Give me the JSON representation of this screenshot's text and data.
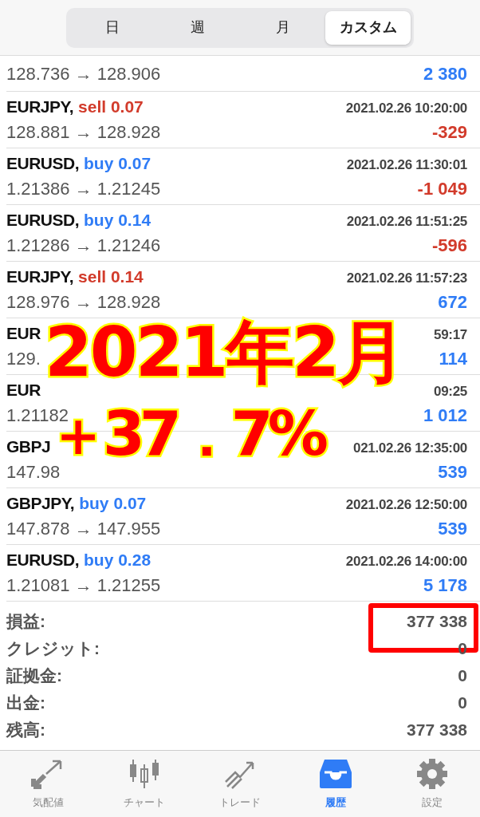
{
  "periods": [
    {
      "label": "日",
      "selected": false
    },
    {
      "label": "週",
      "selected": false
    },
    {
      "label": "月",
      "selected": false
    },
    {
      "label": "カスタム",
      "selected": true
    }
  ],
  "deals": [
    {
      "prices": "128.736 → 128.906",
      "profit": "2 380",
      "loss": false
    },
    {
      "symbol": "EURJPY,",
      "kind": "sell",
      "trade": "sell 0.07",
      "time": "2021.02.26 10:20:00",
      "prices": "128.881 → 128.928",
      "profit": "-329",
      "loss": true
    },
    {
      "symbol": "EURUSD,",
      "kind": "buy",
      "trade": "buy 0.07",
      "time": "2021.02.26 11:30:01",
      "prices": "1.21386 → 1.21245",
      "profit": "-1 049",
      "loss": true
    },
    {
      "symbol": "EURUSD,",
      "kind": "buy",
      "trade": "buy 0.14",
      "time": "2021.02.26 11:51:25",
      "prices": "1.21286 → 1.21246",
      "profit": "-596",
      "loss": true
    },
    {
      "symbol": "EURJPY,",
      "kind": "sell",
      "trade": "sell 0.14",
      "time": "2021.02.26 11:57:23",
      "prices": "128.976 → 128.928",
      "profit": "672",
      "loss": false
    },
    {
      "symbol": "EUR",
      "time": "59:17",
      "prices": "129.",
      "profit": "114",
      "loss": false
    },
    {
      "symbol": "EUR",
      "time": "09:25",
      "prices": "1.21182",
      "profit": "1 012",
      "loss": false
    },
    {
      "symbol": "GBPJ",
      "time": "021.02.26 12:35:00",
      "prices": "147.98",
      "profit": "539",
      "loss": false
    },
    {
      "symbol": "GBPJPY,",
      "kind": "buy",
      "trade": "buy 0.07",
      "time": "2021.02.26 12:50:00",
      "prices": "147.878 → 147.955",
      "profit": "539",
      "loss": false
    },
    {
      "symbol": "EURUSD,",
      "kind": "buy",
      "trade": "buy 0.28",
      "time": "2021.02.26 14:00:00",
      "prices": "1.21081 → 1.21255",
      "profit": "5 178",
      "loss": false
    }
  ],
  "summary": [
    {
      "label": "損益:",
      "value": "377 338",
      "highlighted": true
    },
    {
      "label": "クレジット:",
      "value": "0",
      "highlighted": false
    },
    {
      "label": "証拠金:",
      "value": "0",
      "highlighted": false
    },
    {
      "label": "出金:",
      "value": "0",
      "highlighted": false
    },
    {
      "label": "残高:",
      "value": "377 338",
      "highlighted": false
    }
  ],
  "overlay": {
    "line_1": "2021年2月",
    "line_2": "＋37．7%"
  },
  "tabs": [
    {
      "label": "気配値",
      "selected": false
    },
    {
      "label": "チャート",
      "selected": false
    },
    {
      "label": "トレード",
      "selected": false
    },
    {
      "label": "履歴",
      "selected": true
    },
    {
      "label": "設定",
      "selected": false
    }
  ]
}
